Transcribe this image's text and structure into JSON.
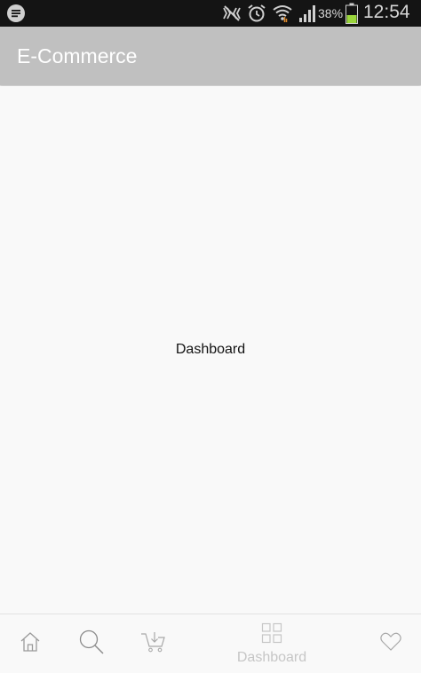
{
  "status_bar": {
    "left_icon": "message-bubble-icon",
    "icons": [
      "mute-icon",
      "alarm-icon",
      "wifi-icon",
      "signal-icon",
      "battery-icon"
    ],
    "battery_percent": "38%",
    "time": "12:54"
  },
  "app_bar": {
    "title": "E-Commerce",
    "background_color": "#c0c0c0"
  },
  "main": {
    "label": "Dashboard"
  },
  "bottom_nav": {
    "items": [
      {
        "icon": "home-icon",
        "label": ""
      },
      {
        "icon": "search-icon",
        "label": ""
      },
      {
        "icon": "cart-icon",
        "label": ""
      },
      {
        "icon": "dashboard-grid-icon",
        "label": "Dashboard",
        "selected": true
      },
      {
        "icon": "heart-icon",
        "label": ""
      }
    ]
  }
}
